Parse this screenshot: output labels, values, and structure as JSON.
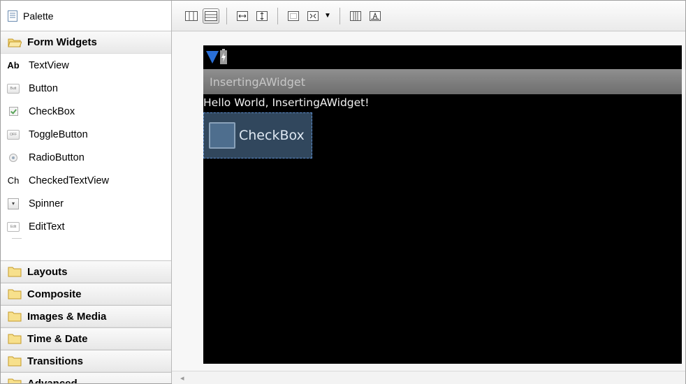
{
  "palette": {
    "title": "Palette",
    "open_category": "Form Widgets",
    "widgets": [
      {
        "label": "TextView",
        "icon": "textview-icon",
        "icon_text": "Ab"
      },
      {
        "label": "Button",
        "icon": "button-icon",
        "icon_text": "Butt"
      },
      {
        "label": "CheckBox",
        "icon": "checkbox-icon"
      },
      {
        "label": "ToggleButton",
        "icon": "togglebutton-icon",
        "icon_text": "OFF"
      },
      {
        "label": "RadioButton",
        "icon": "radiobutton-icon"
      },
      {
        "label": "CheckedTextView",
        "icon": "checkedtextview-icon",
        "icon_text": "Ch"
      },
      {
        "label": "Spinner",
        "icon": "spinner-icon"
      },
      {
        "label": "EditText",
        "icon": "edittext-icon",
        "icon_text": "Edit"
      }
    ],
    "categories": [
      "Layouts",
      "Composite",
      "Images & Media",
      "Time & Date",
      "Transitions",
      "Advanced"
    ]
  },
  "device": {
    "app_title": "InsertingAWidget",
    "hello_text": "Hello World, InsertingAWidget!",
    "checkbox_label": "CheckBox"
  },
  "colors": {
    "selection": "#5a82aa",
    "screen_bg": "#000000",
    "title_bar": "#7d7d7d"
  }
}
